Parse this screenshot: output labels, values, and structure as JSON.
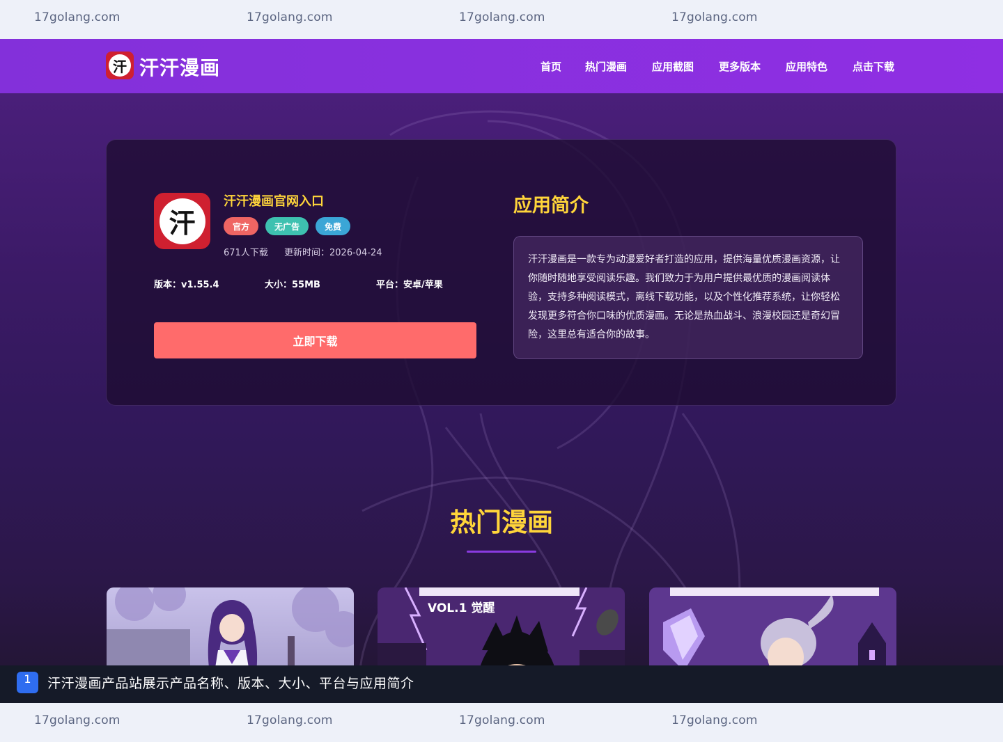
{
  "watermark": {
    "text": "17golang.com"
  },
  "nav": {
    "logo_glyph": "汗",
    "logo_text": "汗汗漫画",
    "items": [
      "首页",
      "热门漫画",
      "应用截图",
      "更多版本",
      "应用特色",
      "点击下载"
    ]
  },
  "app": {
    "icon_glyph": "汗",
    "title": "汗汗漫画官网入口",
    "badges": [
      "官方",
      "无广告",
      "免费"
    ],
    "downloads": "671人下载",
    "updated": "更新时间：2026-04-24",
    "version": "版本：v1.55.4",
    "size": "大小：55MB",
    "platform": "平台：安卓/苹果",
    "download_button": "立即下载"
  },
  "intro": {
    "title": "应用简介",
    "text": "汗汗漫画是一款专为动漫爱好者打造的应用，提供海量优质漫画资源，让你随时随地享受阅读乐趣。我们致力于为用户提供最优质的漫画阅读体验，支持多种阅读模式，离线下载功能，以及个性化推荐系统，让你轻松发现更多符合你口味的优质漫画。无论是热血战斗、浪漫校园还是奇幻冒险，这里总有适合你的故事。"
  },
  "hot": {
    "title": "热门漫画",
    "thumbs": [
      {
        "label": ""
      },
      {
        "label": "VOL.1 觉醒"
      },
      {
        "label": ""
      }
    ]
  },
  "caption": {
    "number": "1",
    "text": "汗汗漫画产品站展示产品名称、版本、大小、平台与应用简介"
  },
  "colors": {
    "nav": "#8a2be2",
    "accent_yellow": "#ffd53a",
    "download_button": "#ff6b6b"
  }
}
